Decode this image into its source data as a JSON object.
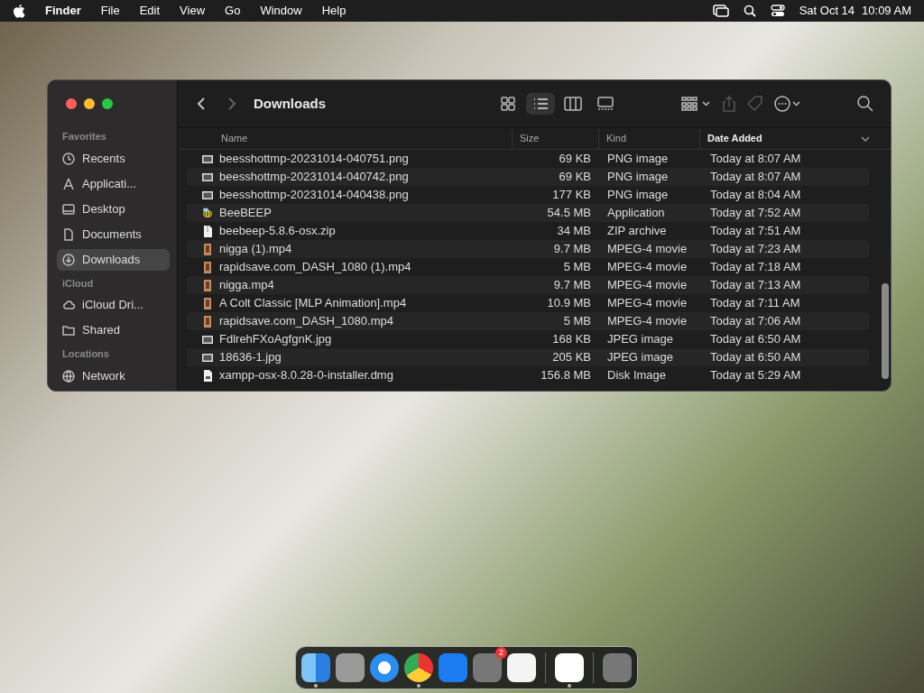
{
  "menu_bar": {
    "app_name": "Finder",
    "menus": [
      "File",
      "Edit",
      "View",
      "Go",
      "Window",
      "Help"
    ],
    "date": "Sat Oct 14",
    "time": "10:09 AM"
  },
  "window": {
    "title": "Downloads",
    "toolbar": {
      "views": [
        {
          "kind": "icons",
          "selected": false
        },
        {
          "kind": "list",
          "selected": true
        },
        {
          "kind": "columns",
          "selected": false
        },
        {
          "kind": "gallery",
          "selected": false
        }
      ]
    },
    "sidebar": [
      {
        "heading": "Favorites",
        "items": [
          {
            "label": "Recents",
            "selected": false
          },
          {
            "label": "Applicati...",
            "selected": false
          },
          {
            "label": "Desktop",
            "selected": false
          },
          {
            "label": "Documents",
            "selected": false
          },
          {
            "label": "Downloads",
            "selected": true
          }
        ]
      },
      {
        "heading": "iCloud",
        "items": [
          {
            "label": "iCloud Dri...",
            "selected": false
          },
          {
            "label": "Shared",
            "selected": false
          }
        ]
      },
      {
        "heading": "Locations",
        "items": [
          {
            "label": "Network",
            "selected": false
          }
        ]
      }
    ],
    "columns": [
      {
        "label": "Name",
        "sorted": false
      },
      {
        "label": "Size",
        "sorted": false
      },
      {
        "label": "Kind",
        "sorted": false
      },
      {
        "label": "Date Added",
        "sorted": true
      }
    ],
    "rows": [
      {
        "kind": "image",
        "name": "beesshottmp-20231014-040751.png",
        "size": "69 KB",
        "file_kind": "PNG image",
        "date": "Today at 8:07 AM"
      },
      {
        "kind": "image",
        "name": "beesshottmp-20231014-040742.png",
        "size": "69 KB",
        "file_kind": "PNG image",
        "date": "Today at 8:07 AM"
      },
      {
        "kind": "image",
        "name": "beesshottmp-20231014-040438.png",
        "size": "177 KB",
        "file_kind": "PNG image",
        "date": "Today at 8:04 AM"
      },
      {
        "kind": "app",
        "name": "BeeBEEP",
        "size": "54.5 MB",
        "file_kind": "Application",
        "date": "Today at 7:52 AM"
      },
      {
        "kind": "zip",
        "name": "beebeep-5.8.6-osx.zip",
        "size": "34 MB",
        "file_kind": "ZIP archive",
        "date": "Today at 7:51 AM"
      },
      {
        "kind": "video",
        "name": "nigga (1).mp4",
        "size": "9.7 MB",
        "file_kind": "MPEG-4 movie",
        "date": "Today at 7:23 AM"
      },
      {
        "kind": "video",
        "name": "rapidsave.com_DASH_1080 (1).mp4",
        "size": "5 MB",
        "file_kind": "MPEG-4 movie",
        "date": "Today at 7:18 AM"
      },
      {
        "kind": "video",
        "name": "nigga.mp4",
        "size": "9.7 MB",
        "file_kind": "MPEG-4 movie",
        "date": "Today at 7:13 AM"
      },
      {
        "kind": "video",
        "name": "A Colt Classic [MLP Animation].mp4",
        "size": "10.9 MB",
        "file_kind": "MPEG-4 movie",
        "date": "Today at 7:11 AM"
      },
      {
        "kind": "video",
        "name": "rapidsave.com_DASH_1080.mp4",
        "size": "5 MB",
        "file_kind": "MPEG-4 movie",
        "date": "Today at 7:06 AM"
      },
      {
        "kind": "image",
        "name": "FdlrehFXoAgfgnK.jpg",
        "size": "168 KB",
        "file_kind": "JPEG image",
        "date": "Today at 6:50 AM"
      },
      {
        "kind": "image",
        "name": "18636-1.jpg",
        "size": "205 KB",
        "file_kind": "JPEG image",
        "date": "Today at 6:50 AM"
      },
      {
        "kind": "dmg",
        "name": "xampp-osx-8.0.28-0-installer.dmg",
        "size": "156.8 MB",
        "file_kind": "Disk Image",
        "date": "Today at 5:29 AM"
      }
    ]
  },
  "dock": [
    {
      "running": true
    },
    {
      "running": false
    },
    {
      "running": false
    },
    {
      "running": true
    },
    {
      "running": false
    },
    {
      "running": false,
      "badge": "2"
    },
    {
      "running": false
    },
    {
      "running": true,
      "separator_before": true
    },
    {
      "running": false,
      "separator_before": true
    }
  ]
}
